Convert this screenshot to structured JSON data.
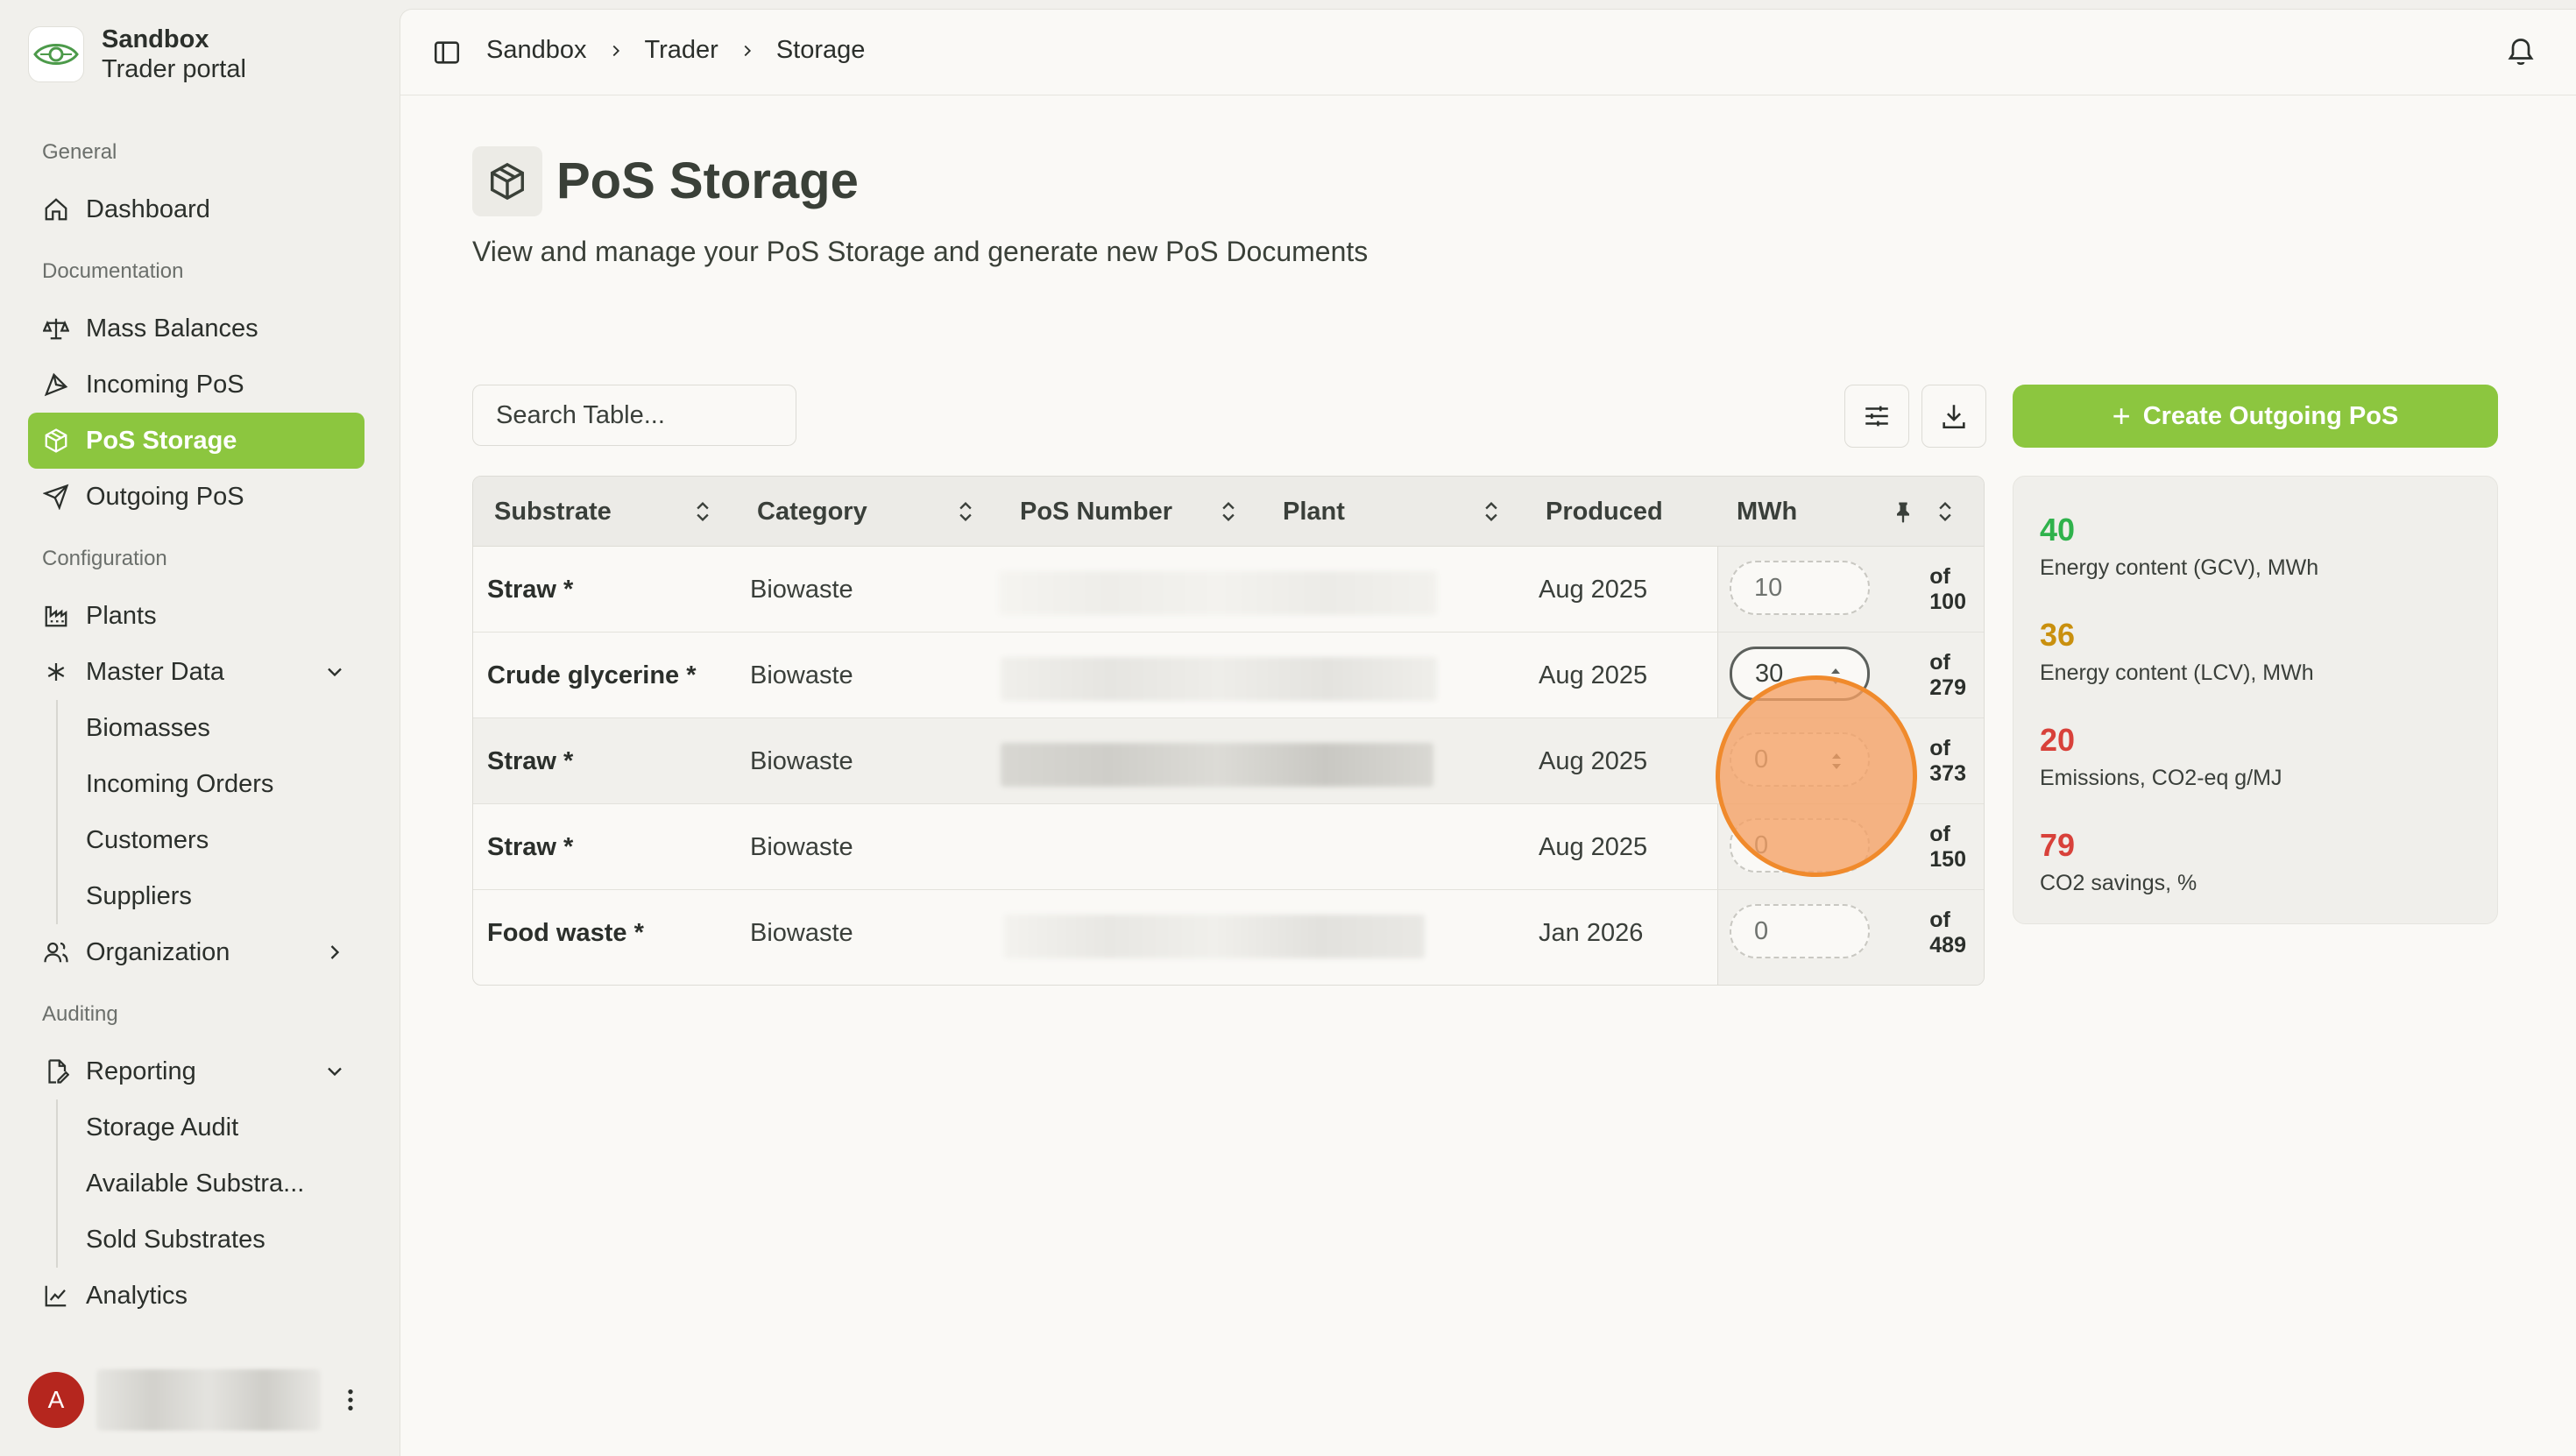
{
  "brand": {
    "name": "Sandbox",
    "subtitle": "Trader portal"
  },
  "sidebar": {
    "sections": {
      "general": "General",
      "documentation": "Documentation",
      "configuration": "Configuration",
      "auditing": "Auditing"
    },
    "items": {
      "dashboard": "Dashboard",
      "mass_balances": "Mass Balances",
      "incoming_pos": "Incoming PoS",
      "pos_storage": "PoS Storage",
      "outgoing_pos": "Outgoing PoS",
      "plants": "Plants",
      "master_data": "Master Data",
      "biomasses": "Biomasses",
      "incoming_orders": "Incoming Orders",
      "customers": "Customers",
      "suppliers": "Suppliers",
      "organization": "Organization",
      "reporting": "Reporting",
      "storage_audit": "Storage Audit",
      "available_substrates": "Available Substra...",
      "sold_substrates": "Sold Substrates",
      "analytics": "Analytics"
    },
    "active": "pos_storage",
    "user": {
      "initial": "A"
    }
  },
  "breadcrumb": [
    "Sandbox",
    "Trader",
    "Storage"
  ],
  "page": {
    "title": "PoS Storage",
    "subtitle": "View and manage your PoS Storage and generate new PoS Documents"
  },
  "toolbar": {
    "search_placeholder": "Search Table...",
    "create_label": "Create Outgoing PoS"
  },
  "table": {
    "columns": [
      "Substrate",
      "Category",
      "PoS Number",
      "Plant",
      "Produced",
      "MWh"
    ],
    "rows": [
      {
        "substrate": "Straw *",
        "category": "Biowaste",
        "produced": "Aug 2025",
        "mwh": "10",
        "of": "of 100"
      },
      {
        "substrate": "Crude glycerine *",
        "category": "Biowaste",
        "produced": "Aug 2025",
        "mwh": "30",
        "of": "of 279"
      },
      {
        "substrate": "Straw *",
        "category": "Biowaste",
        "produced": "Aug 2025",
        "mwh": "0",
        "of": "of 373"
      },
      {
        "substrate": "Straw *",
        "category": "Biowaste",
        "produced": "Aug 2025",
        "mwh": "0",
        "of": "of 150"
      },
      {
        "substrate": "Food waste *",
        "category": "Biowaste",
        "produced": "Jan 2026",
        "mwh": "0",
        "of": "of 489"
      }
    ]
  },
  "stats": [
    {
      "value": "40",
      "label": "Energy content (GCV), MWh",
      "color": "#2fb24c"
    },
    {
      "value": "36",
      "label": "Energy content (LCV), MWh",
      "color": "#c9900e"
    },
    {
      "value": "20",
      "label": "Emissions, CO2-eq g/MJ",
      "color": "#d8413a"
    },
    {
      "value": "79",
      "label": "CO2 savings, %",
      "color": "#d8413a"
    }
  ],
  "colors": {
    "accent": "#8cc63f",
    "click_highlight": "#f08a2c"
  }
}
